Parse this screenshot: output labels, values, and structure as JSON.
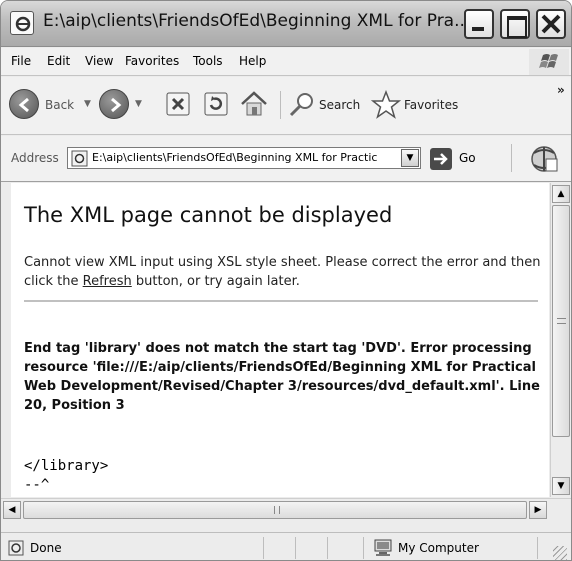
{
  "window": {
    "title": "E:\\aip\\clients\\FriendsOfEd\\Beginning XML for Pra..."
  },
  "menu": {
    "items": [
      "File",
      "Edit",
      "View",
      "Favorites",
      "Tools",
      "Help"
    ]
  },
  "toolbar": {
    "back_label": "Back",
    "search_label": "Search",
    "favorites_label": "Favorites",
    "overflow": "»"
  },
  "address": {
    "label": "Address",
    "value": "E:\\aip\\clients\\FriendsOfEd\\Beginning XML for Practic",
    "go_label": "Go"
  },
  "page": {
    "heading": "The XML page cannot be displayed",
    "message_pre": "Cannot view XML input using XSL style sheet. Please correct the error and then click the ",
    "message_link": "Refresh",
    "message_post": " button, or try again later.",
    "error": "End tag 'library' does not match the start tag 'DVD'. Error processing resource 'file:///E:/aip/clients/FriendsOfEd/Beginning XML for Practical Web Development/Revised/Chapter 3/resources/dvd_default.xml'. Line 20, Position 3",
    "source_line": "</library>",
    "source_caret": "--^"
  },
  "status": {
    "text": "Done",
    "zone": "My Computer"
  }
}
